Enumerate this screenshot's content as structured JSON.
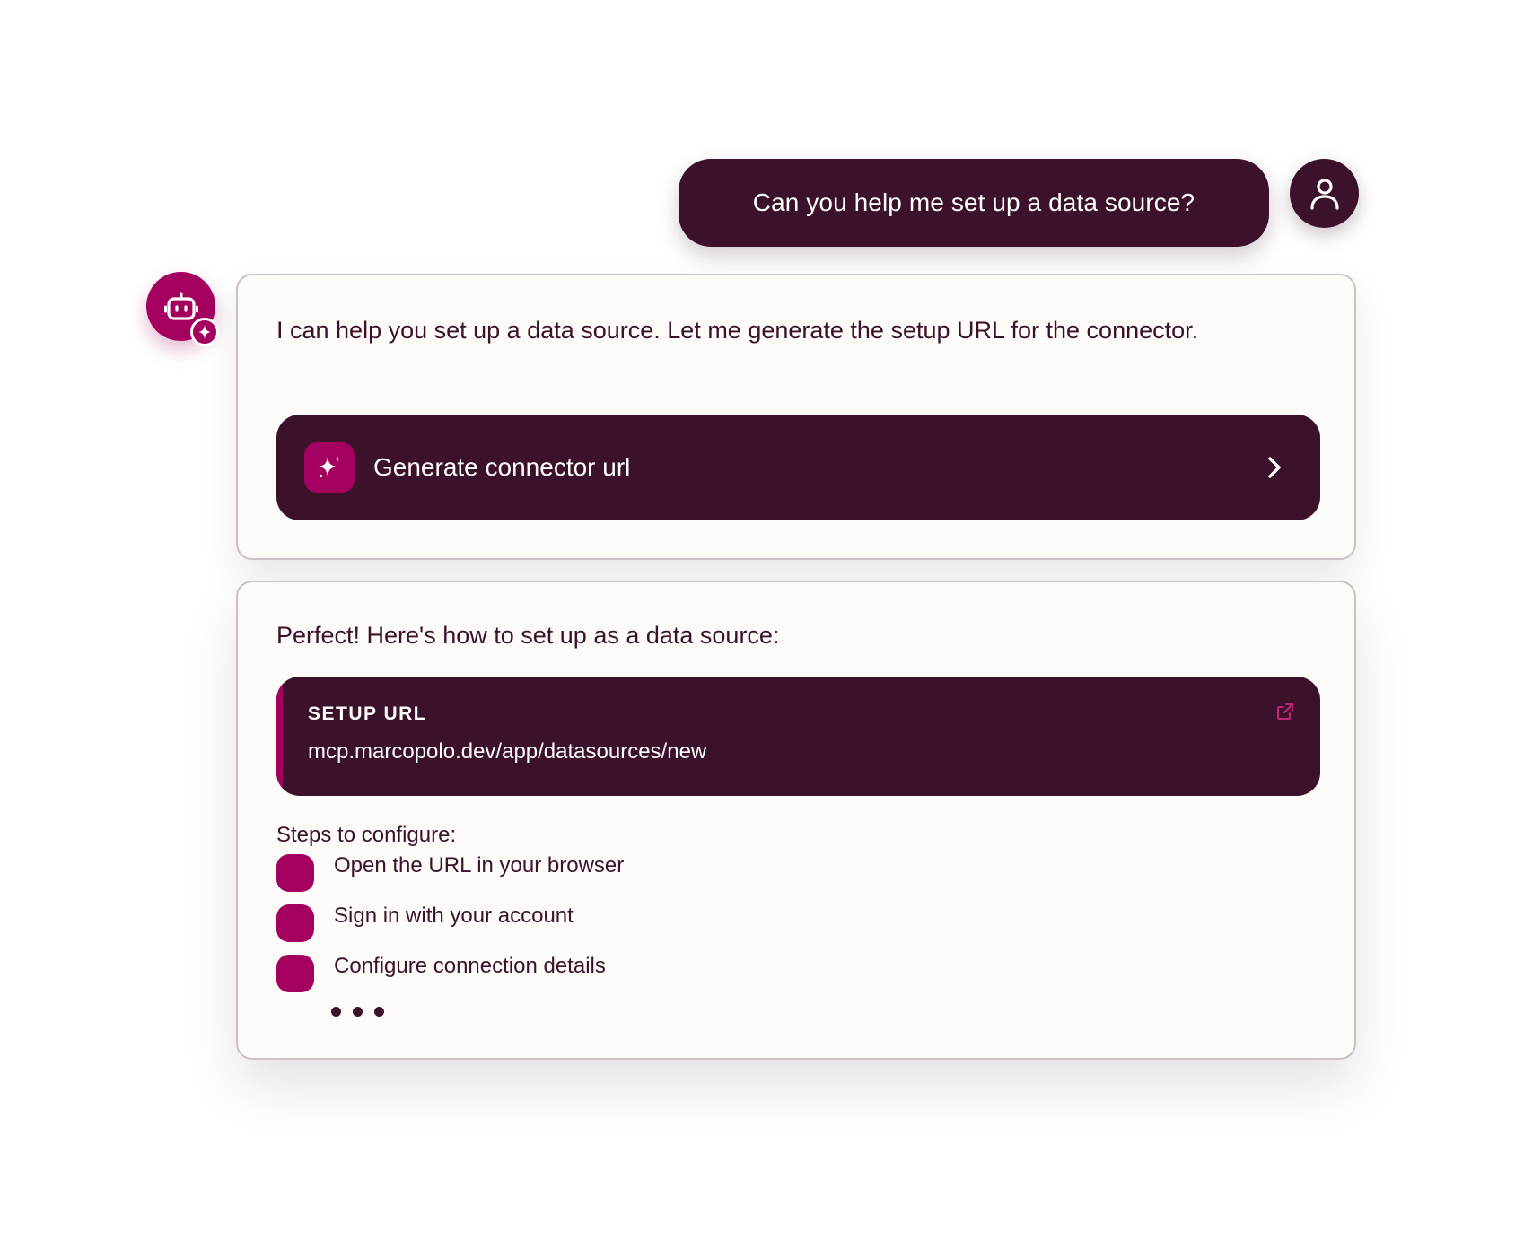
{
  "user_message": {
    "text": "Can you help me set up a data source?",
    "avatar_icon": "user-icon"
  },
  "assistant": {
    "avatar_icon": "robot-icon",
    "badge_icon": "sparkle-icon",
    "message_1": {
      "text": "I can help you set up a data source. Let me generate the setup URL for the connector.",
      "action": {
        "label": "Generate connector url",
        "icon": "sparkle-icon",
        "trailing_icon": "chevron-right-icon"
      }
    },
    "message_2": {
      "text": "Perfect! Here's how to set up as a data source:",
      "setup_url": {
        "label": "SETUP URL",
        "value": "mcp.marcopolo.dev/app/datasources/new",
        "icon": "external-link-icon"
      },
      "steps_heading": "Steps to configure:",
      "steps": [
        "Open the URL in your browser",
        "Sign in with your account",
        "Configure connection details"
      ],
      "typing_indicator": true
    }
  },
  "colors": {
    "primary_dark": "#3b1229",
    "accent": "#a3005f",
    "card_background": "#fcfbf8",
    "card_border": "#cdbfc6"
  }
}
